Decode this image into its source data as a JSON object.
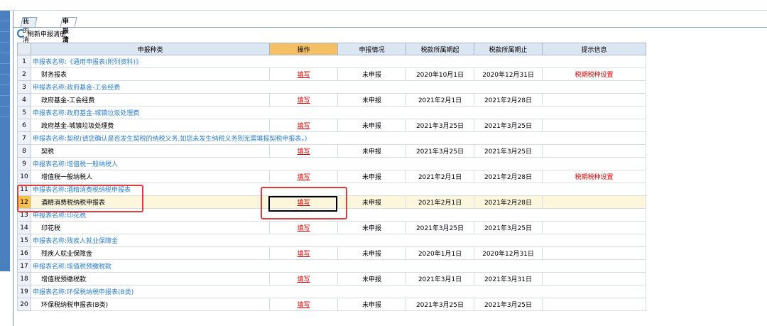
{
  "tabs": [
    "我的消息",
    "申报清册"
  ],
  "toolbar": {
    "refresh_label": "刷新申报清册"
  },
  "columns": [
    "申报种类",
    "操作",
    "申报情况",
    "税款所属期起",
    "税款所属期止",
    "提示信息"
  ],
  "rows": [
    {
      "n": "1",
      "type": "group",
      "label": "申报表名称:《通用申报表(附列资料)》"
    },
    {
      "n": "2",
      "type": "item",
      "label": "财务报表",
      "op": "填写",
      "status": "未申报",
      "start": "2020年10月1日",
      "end": "2020年12月31日",
      "tip": "税期税种设置"
    },
    {
      "n": "3",
      "type": "group",
      "label": "申报表名称:政府基金-工会经费"
    },
    {
      "n": "4",
      "type": "item",
      "label": "政府基金-工会经费",
      "op": "填写",
      "status": "未申报",
      "start": "2021年2月1日",
      "end": "2021年2月28日",
      "tip": ""
    },
    {
      "n": "5",
      "type": "group",
      "label": "申报表名称:政府基金-城镇垃圾处理费"
    },
    {
      "n": "6",
      "type": "item",
      "label": "政府基金-城镇垃圾处理费",
      "op": "填写",
      "status": "未申报",
      "start": "2021年3月25日",
      "end": "2021年3月25日",
      "tip": ""
    },
    {
      "n": "7",
      "type": "group",
      "label": "申报表名称:契税(请您确认是否发生契税的纳税义务,如您未发生纳税义务则无需填报契税申报表。)"
    },
    {
      "n": "8",
      "type": "item",
      "label": "契税",
      "op": "填写",
      "status": "未申报",
      "start": "2021年3月25日",
      "end": "2021年3月25日",
      "tip": ""
    },
    {
      "n": "9",
      "type": "group",
      "label": "申报表名称:增值税一般纳税人"
    },
    {
      "n": "10",
      "type": "item",
      "label": "增值税一般纳税人",
      "op": "填写",
      "status": "未申报",
      "start": "2021年2月1日",
      "end": "2021年2月28日",
      "tip": "税期税种设置"
    },
    {
      "n": "11",
      "type": "group",
      "label": "申报表名称:酒精消费税纳税申报表"
    },
    {
      "n": "12",
      "type": "item",
      "label": "酒精消费税纳税申报表",
      "op": "填写",
      "status": "未申报",
      "start": "2021年2月1日",
      "end": "2021年2月28日",
      "tip": ""
    },
    {
      "n": "13",
      "type": "group",
      "label": "申报表名称:印花税"
    },
    {
      "n": "14",
      "type": "item",
      "label": "印花税",
      "op": "填写",
      "status": "未申报",
      "start": "2021年3月25日",
      "end": "2021年3月25日",
      "tip": ""
    },
    {
      "n": "15",
      "type": "group",
      "label": "申报表名称:残疾人就业保障金"
    },
    {
      "n": "16",
      "type": "item",
      "label": "残疾人就业保障金",
      "op": "填写",
      "status": "未申报",
      "start": "2020年1月1日",
      "end": "2020年12月31日",
      "tip": ""
    },
    {
      "n": "17",
      "type": "group",
      "label": "申报表名称:增值税预缴税款"
    },
    {
      "n": "18",
      "type": "item",
      "label": "增值税预缴税款",
      "op": "填写",
      "status": "未申报",
      "start": "2021年3月1日",
      "end": "2021年3月31日",
      "tip": ""
    },
    {
      "n": "19",
      "type": "group",
      "label": "申报表名称:环保税纳税申报表(B类)"
    },
    {
      "n": "20",
      "type": "item",
      "label": "环保税纳税申报表(B类)",
      "op": "填写",
      "status": "未申报",
      "start": "2021年3月25日",
      "end": "2021年3月25日",
      "tip": ""
    }
  ],
  "selected_row": "12",
  "colors": {
    "link_red": "#e00000",
    "group_blue": "#2b7fd0",
    "highlight": "#e03c3c",
    "selected_num": "#f6c04b"
  }
}
